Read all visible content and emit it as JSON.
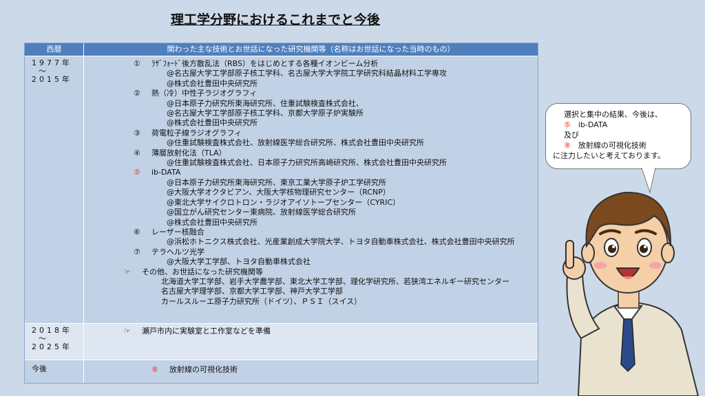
{
  "title": "理工学分野におけるこれまでと今後",
  "table": {
    "headers": {
      "year": "西暦",
      "content": "関わった主な技術とお世話になった研究機関等（名称はお世話になった当時のもの）"
    },
    "rows": [
      {
        "year_start": "1977年",
        "year_sep": "～",
        "year_end": "2015年",
        "items": [
          {
            "num": "①",
            "title": "ﾗｻﾞﾌｫｰﾄﾞ後方散乱法（RBS）をはじめとする各種イオンビーム分析",
            "subs": [
              "@名古屋大学工学部原子核工学科、名古屋大学大学院工学研究科結晶材料工学専攻",
              "@株式会社豊田中央研究所"
            ]
          },
          {
            "num": "②",
            "title": "熱（冷）中性子ラジオグラフィ",
            "subs": [
              "@日本原子力研究所東海研究所、住重試験検査株式会社、",
              "@名古屋大学工学部原子核工学科、京都大学原子炉実験所",
              "@株式会社豊田中央研究所"
            ]
          },
          {
            "num": "③",
            "title": "荷電粒子線ラジオグラフィ",
            "subs": [
              "@住重試験検査株式会社、放射線医学総合研究所、株式会社豊田中央研究所"
            ]
          },
          {
            "num": "④",
            "title": "薄層放射化法（TLA）",
            "subs": [
              "@住重試験検査株式会社、日本原子力研究所高崎研究所、株式会社豊田中央研究所"
            ]
          },
          {
            "num": "⑤",
            "title": "ib-DATA",
            "highlight": true,
            "subs": [
              "@日本原子力研究所東海研究所、東京工業大学原子炉工学研究所",
              "@大阪大学オクタビアン、大阪大学核物理研究センター（RCNP）",
              "@東北大学サイクロトロン・ラジオアイソトープセンター（CYRIC）",
              "@国立がん研究センター東病院、放射線医学総合研究所",
              "@株式会社豊田中央研究所"
            ]
          },
          {
            "num": "⑥",
            "title": "レーザー核融合",
            "subs": [
              "@浜松ホトニクス株式会社、光産業創成大学院大学、トヨタ自動車株式会社、株式会社豊田中央研究所"
            ]
          },
          {
            "num": "⑦",
            "title": "テラヘルツ光学",
            "subs": [
              "@大阪大学工学部、トヨタ自動車株式会社"
            ]
          }
        ],
        "other": {
          "marker": "☞",
          "title": "その他、お世話になった研究機関等",
          "subs": [
            "北海道大学工学部、岩手大学農学部、東北大学工学部、理化学研究所、若狭湾エネルギー研究センター",
            "名古屋大学理学部、京都大学工学部、神戸大学工学部",
            "カールスルーエ原子力研究所（ドイツ）、ＰＳＩ（スイス）"
          ]
        }
      },
      {
        "year_start": "2018年",
        "year_sep": "～",
        "year_end": "2025年",
        "marker": "☞",
        "text": "瀬戸市内に実験室と工作室などを準備"
      },
      {
        "year": "今後",
        "num": "⑧",
        "text": "放射線の可視化技術"
      }
    ]
  },
  "bubble": {
    "line1": "選択と集中の結果、今後は、",
    "num5": "⑤",
    "item5": "ib-DATA",
    "and": "及び",
    "num8": "⑧",
    "item8": "放射線の可視化技術",
    "line5": "に注力したいと考えております。"
  },
  "colors": {
    "background": "#ccd9e8",
    "header": "#4f7fbd",
    "row_a": "#c2d2e6",
    "row_b": "#dde6f1",
    "highlight": "#e53935"
  }
}
